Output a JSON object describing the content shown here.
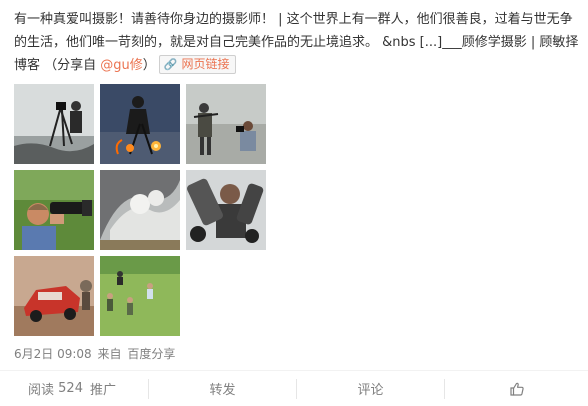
{
  "post": {
    "text_before_mention": "有一种真爱叫摄影！请善待你身边的摄影师！ | 这个世界上有一群人，他们很善良，过着与世无争的生活，他们唯一苛刻的，就是对自己完美作品的无止境追求。 &nbs [...]___顾修学摄影 | 顾敏择博客 （分享自 ",
    "mention": "@gu修",
    "text_after_mention": "）",
    "web_link_label": "网页链接",
    "link_icon": "link-icon"
  },
  "images": [
    {
      "name": "photographer-tripod-rocks",
      "alt": "photo"
    },
    {
      "name": "photographer-flares-night",
      "alt": "photo"
    },
    {
      "name": "soldiers-photographers",
      "alt": "photo"
    },
    {
      "name": "photographer-telephoto",
      "alt": "photo"
    },
    {
      "name": "crashing-wave",
      "alt": "photo"
    },
    {
      "name": "photographer-big-lens",
      "alt": "photo"
    },
    {
      "name": "car-crash-rally",
      "alt": "photo"
    },
    {
      "name": "people-running-field",
      "alt": "photo"
    }
  ],
  "meta": {
    "date": "6月2日 09:08",
    "from_label": "来自",
    "source": "百度分享"
  },
  "actions": {
    "read_label": "阅读",
    "read_count": "524",
    "promote_label": "推广",
    "share_label": "转发",
    "comment_label": "评论",
    "like_icon": "thumbs-up-icon"
  },
  "colors": {
    "accent": "#eb7350",
    "muted": "#808080",
    "text": "#333333"
  }
}
